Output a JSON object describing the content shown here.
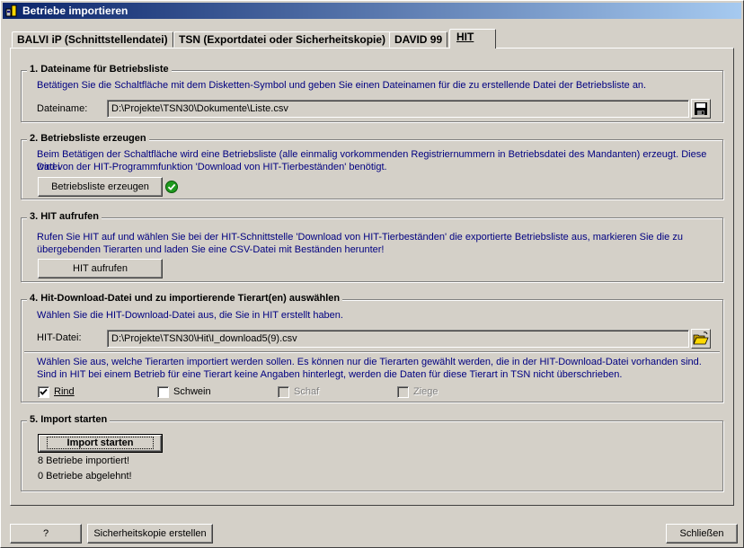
{
  "window": {
    "title": "Betriebe importieren"
  },
  "tabs": [
    {
      "label": "BALVI iP (Schnittstellendatei)"
    },
    {
      "label": "TSN (Exportdatei oder Sicherheitskopie)"
    },
    {
      "label": "DAVID 99"
    },
    {
      "label": "HIT"
    }
  ],
  "section1": {
    "title": "1. Dateiname für Betriebsliste",
    "description": "Betätigen Sie die Schaltfläche mit dem Disketten-Symbol und geben Sie einen Dateinamen für die zu erstellende Datei der Betriebsliste an.",
    "file_label": "Dateiname:",
    "file_value": "D:\\Projekte\\TSN30\\Dokumente\\Liste.csv",
    "save_icon": "floppy-disk-icon"
  },
  "section2": {
    "title": "2. Betriebsliste erzeugen",
    "description_line1": "Beim Betätigen der Schaltfläche wird eine Betriebsliste (alle einmalig vorkommenden Registriernummern in Betriebsdatei des Mandanten) erzeugt. Diese Datei",
    "description_line2": "wird von der HIT-Programmfunktion 'Download von HIT-Tierbeständen' benötigt.",
    "button_label": "Betriebsliste erzeugen",
    "status_icon": "check-icon"
  },
  "section3": {
    "title": "3. HIT aufrufen",
    "description_line1": "Rufen Sie HIT auf und wählen Sie bei der HIT-Schnittstelle 'Download von HIT-Tierbeständen' die exportierte Betriebsliste aus, markieren Sie die zu",
    "description_line2": "übergebenden Tierarten und laden Sie eine CSV-Datei mit Beständen herunter!",
    "button_label": "HIT aufrufen"
  },
  "section4": {
    "title": "4. Hit-Download-Datei und zu importierende Tierart(en) auswählen",
    "description": "Wählen Sie die HIT-Download-Datei aus, die Sie in HIT erstellt haben.",
    "file_label": "HIT-Datei:",
    "file_value": "D:\\Projekte\\TSN30\\Hit\\I_download5(9).csv",
    "open_icon": "open-folder-icon",
    "species_hint_line1": "Wählen Sie aus, welche Tierarten importiert werden sollen. Es können nur die Tierarten gewählt werden, die in der HIT-Download-Datei vorhanden sind.",
    "species_hint_line2": "Sind in HIT bei einem Betrieb für eine Tierart keine Angaben hinterlegt, werden die Daten für diese Tierart in TSN nicht überschrieben.",
    "species": [
      {
        "label": "Rind",
        "checked": true,
        "enabled": true
      },
      {
        "label": "Schwein",
        "checked": false,
        "enabled": true
      },
      {
        "label": "Schaf",
        "checked": false,
        "enabled": false
      },
      {
        "label": "Ziege",
        "checked": false,
        "enabled": false
      }
    ]
  },
  "section5": {
    "title": "5. Import starten",
    "button_label": "Import starten",
    "result_imported": "8 Betriebe importiert!",
    "result_rejected": "0 Betriebe abgelehnt!"
  },
  "footer": {
    "help_label": "?",
    "backup_label": "Sicherheitskopie erstellen",
    "close_label": "Schließen"
  }
}
